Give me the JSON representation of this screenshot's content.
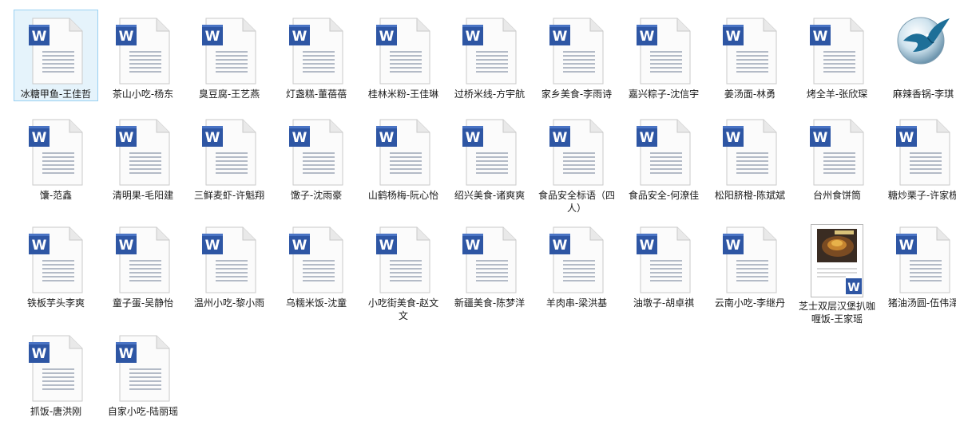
{
  "folder": {
    "files": [
      {
        "name": "冰糖甲鱼-王佳哲",
        "icon": "word-doc-icon",
        "selected": true
      },
      {
        "name": "茶山小吃-杨东",
        "icon": "word-doc-icon"
      },
      {
        "name": "臭豆腐-王艺燕",
        "icon": "word-doc-icon"
      },
      {
        "name": "灯盏糕-董蓓蓓",
        "icon": "word-doc-icon"
      },
      {
        "name": "桂林米粉-王佳琳",
        "icon": "word-doc-icon"
      },
      {
        "name": "过桥米线-方宇航",
        "icon": "word-doc-icon"
      },
      {
        "name": "家乡美食-李雨诗",
        "icon": "word-doc-icon"
      },
      {
        "name": "嘉兴粽子-沈信宇",
        "icon": "word-doc-icon"
      },
      {
        "name": "姜汤面-林勇",
        "icon": "word-doc-icon"
      },
      {
        "name": "烤全羊-张欣琛",
        "icon": "word-doc-icon"
      },
      {
        "name": "麻辣香锅-李琪",
        "icon": "app-bird-icon"
      },
      {
        "name": "馕-范鑫",
        "icon": "word-doc-icon"
      },
      {
        "name": "清明果-毛阳建",
        "icon": "word-doc-icon"
      },
      {
        "name": "三鲜麦虾-许魁翔",
        "icon": "word-doc-icon"
      },
      {
        "name": "馓子-沈雨豪",
        "icon": "word-doc-icon"
      },
      {
        "name": "山鹤杨梅-阮心怡",
        "icon": "word-doc-icon"
      },
      {
        "name": "绍兴美食-诸爽爽",
        "icon": "word-doc-icon"
      },
      {
        "name": "食品安全标语（四人）",
        "icon": "word-doc-icon"
      },
      {
        "name": "食品安全-何潦佳",
        "icon": "word-doc-icon"
      },
      {
        "name": "松阳脐橙-陈斌斌",
        "icon": "word-doc-icon"
      },
      {
        "name": "台州食饼筒",
        "icon": "word-doc-icon"
      },
      {
        "name": "糖炒栗子-许家栋",
        "icon": "word-doc-icon"
      },
      {
        "name": "铁板芋头李爽",
        "icon": "word-doc-icon"
      },
      {
        "name": "童子蛋-吴静怡",
        "icon": "word-doc-icon"
      },
      {
        "name": "温州小吃-黎小雨",
        "icon": "word-doc-icon"
      },
      {
        "name": "乌糯米饭-沈童",
        "icon": "word-doc-icon"
      },
      {
        "name": "小吃街美食-赵文文",
        "icon": "word-doc-icon"
      },
      {
        "name": "新疆美食-陈梦洋",
        "icon": "word-doc-icon"
      },
      {
        "name": "羊肉串-梁洪基",
        "icon": "word-doc-icon"
      },
      {
        "name": "油墩子-胡卓祺",
        "icon": "word-doc-icon"
      },
      {
        "name": "云南小吃-李继丹",
        "icon": "word-doc-icon"
      },
      {
        "name": "芝士双层汉堡扒咖喱饭-王家瑶",
        "icon": "word-thumbnail-icon"
      },
      {
        "name": "猪油汤圆-伍伟泽",
        "icon": "word-doc-icon"
      },
      {
        "name": "抓饭-唐洪刚",
        "icon": "word-doc-icon"
      },
      {
        "name": "自家小吃-陆丽瑶",
        "icon": "word-doc-icon"
      }
    ]
  }
}
